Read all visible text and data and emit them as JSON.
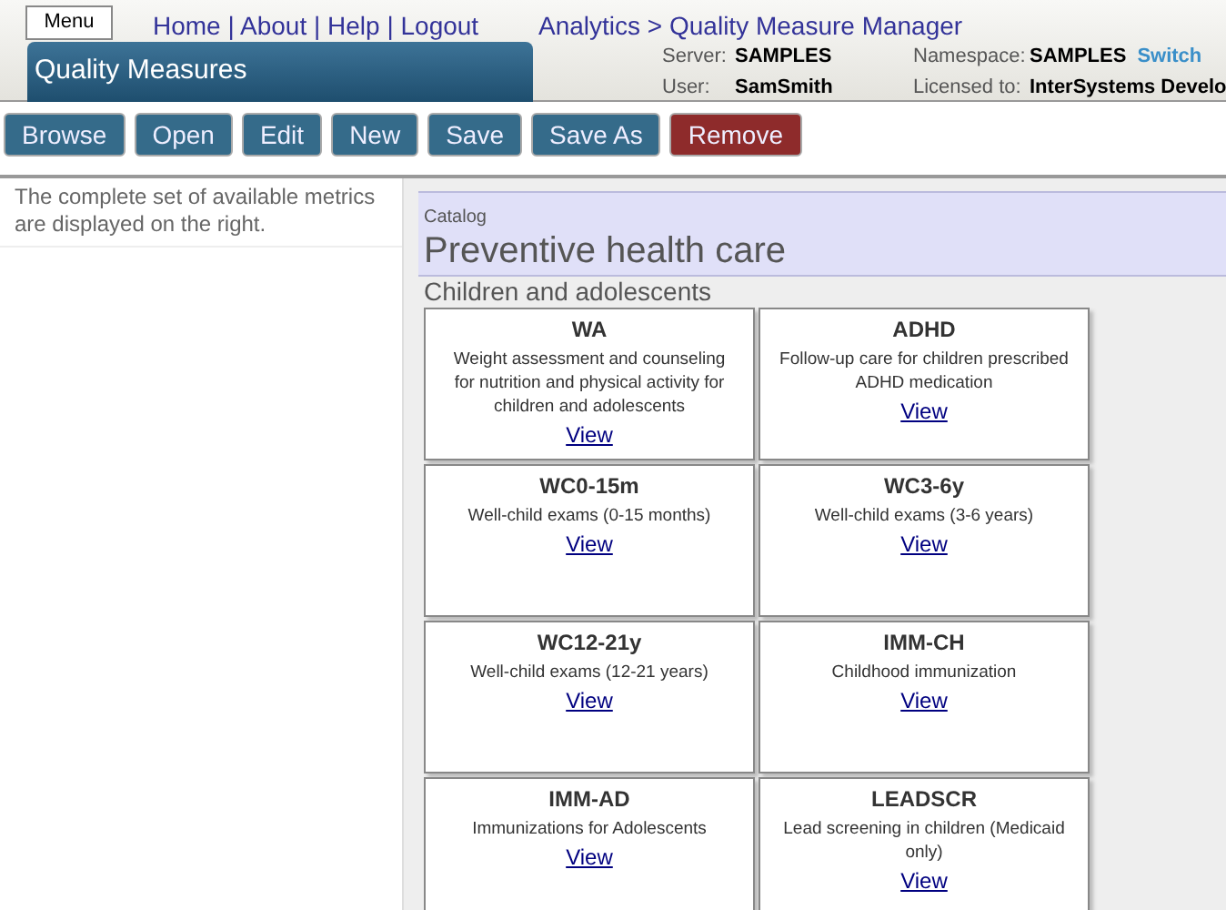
{
  "header": {
    "menu_button": "Menu",
    "nav_links": [
      "Home",
      "About",
      "Help",
      "Logout"
    ],
    "nav_separator": "|",
    "breadcrumb": {
      "parent": "Analytics",
      "separator": ">",
      "current": "Quality Measure Manager"
    },
    "page_title": "Quality Measures",
    "info": [
      {
        "label": "Server:",
        "value": "SAMPLES"
      },
      {
        "label": "Namespace:",
        "value": "SAMPLES",
        "link": "Switch"
      },
      {
        "label": "User:",
        "value": "SamSmith"
      },
      {
        "label": "Licensed to:",
        "value": "InterSystems Develo"
      }
    ]
  },
  "toolbar": [
    {
      "label": "Browse",
      "kind": "normal"
    },
    {
      "label": "Open",
      "kind": "normal"
    },
    {
      "label": "Edit",
      "kind": "normal"
    },
    {
      "label": "New",
      "kind": "normal"
    },
    {
      "label": "Save",
      "kind": "normal"
    },
    {
      "label": "Save As",
      "kind": "normal"
    },
    {
      "label": "Remove",
      "kind": "danger"
    }
  ],
  "sidebar": {
    "text": "The complete set of available metrics are displayed on the right."
  },
  "catalog": {
    "label": "Catalog",
    "title": "Preventive health care",
    "group": "Children and adolescents",
    "measures": [
      {
        "code": "WA",
        "description": "Weight assessment and counseling for nutrition and physical activity for children and adolescents",
        "link": "View"
      },
      {
        "code": "ADHD",
        "description": "Follow-up care for children prescribed ADHD medication",
        "link": "View"
      },
      {
        "code": "WC0-15m",
        "description": "Well-child exams (0-15 months)",
        "link": "View"
      },
      {
        "code": "WC3-6y",
        "description": "Well-child exams (3-6 years)",
        "link": "View"
      },
      {
        "code": "WC12-21y",
        "description": "Well-child exams (12-21 years)",
        "link": "View"
      },
      {
        "code": "IMM-CH",
        "description": "Childhood immunization",
        "link": "View"
      },
      {
        "code": "IMM-AD",
        "description": "Immunizations for Adolescents",
        "link": "View"
      },
      {
        "code": "LEADSCR",
        "description": "Lead screening in children (Medicaid only)",
        "link": "View"
      }
    ]
  }
}
